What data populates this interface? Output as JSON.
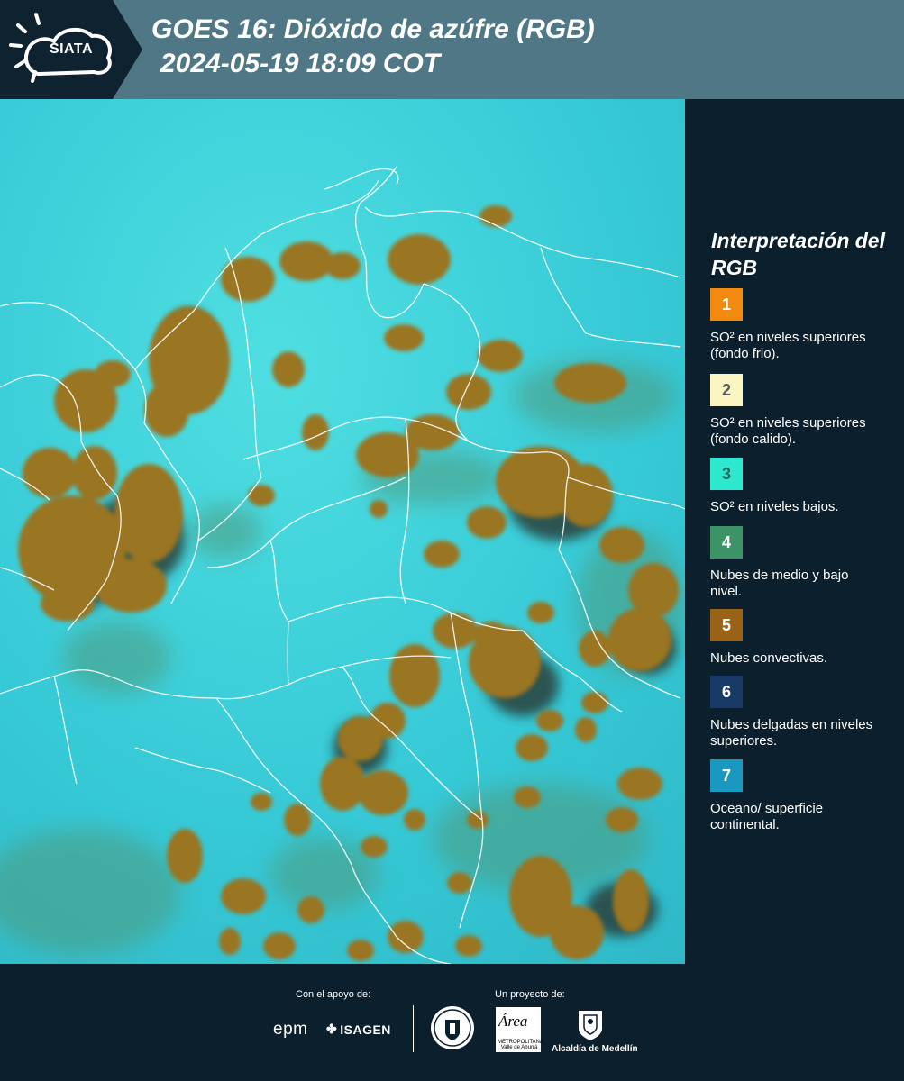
{
  "header": {
    "logo_text": "SIATA",
    "title_line1": "GOES 16: Dióxido de azúfre (RGB)",
    "title_line2": "2024-05-19 18:09 COT"
  },
  "legend": {
    "title": "Interpretación del RGB",
    "items": [
      {
        "number": "1",
        "label": "SO² en niveles superiores (fondo frio).",
        "color": "#f28a10",
        "text_color": "#ffffff"
      },
      {
        "number": "2",
        "label": "SO² en niveles superiores (fondo calido).",
        "color": "#fbf5c4",
        "text_color": "#5a5a5a"
      },
      {
        "number": "3",
        "label": "SO² en niveles bajos.",
        "color": "#2de8cf",
        "text_color": "#1b6a60"
      },
      {
        "number": "4",
        "label": "Nubes de medio y bajo nivel.",
        "color": "#3c9466",
        "text_color": "#ffffff"
      },
      {
        "number": "5",
        "label": "Nubes convectivas.",
        "color": "#9a6216",
        "text_color": "#ffffff"
      },
      {
        "number": "6",
        "label": "Nubes delgadas en niveles superiores.",
        "color": "#173a66",
        "text_color": "#ffffff"
      },
      {
        "number": "7",
        "label": "Oceano/ superficie continental.",
        "color": "#1a98c0",
        "text_color": "#ffffff"
      }
    ]
  },
  "footer": {
    "support_caption": "Con el apoyo de:",
    "project_caption": "Un proyecto de:",
    "epm": "epm",
    "isagen": "ISAGEN",
    "area_logo": "Área",
    "area_sub": "METROPOLITANA Valle de Aburrá",
    "alcaldia": "Alcaldía de Medellín"
  },
  "colors": {
    "map_background": "#36c9d6",
    "cloud_brown": "#9a7424",
    "cloud_dark": "#2b3f3a",
    "cloud_green": "#4f9a7d",
    "border_lines": "#ffffff",
    "panel_background": "#0b1f2c",
    "header_background": "#4f7785"
  }
}
